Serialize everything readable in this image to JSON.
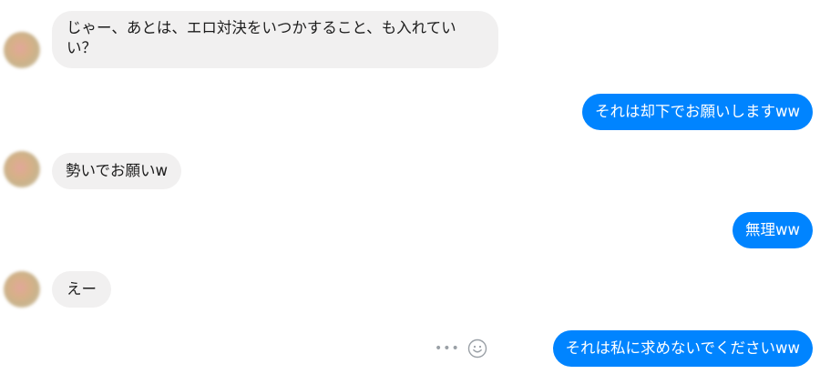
{
  "conversation": {
    "messages": [
      {
        "side": "incoming",
        "text": "じゃー、あとは、エロ対決をいつかすること、も入れていい？"
      },
      {
        "side": "outgoing",
        "text": "それは却下でお願いしますww"
      },
      {
        "side": "incoming",
        "text": "勢いでお願いw"
      },
      {
        "side": "outgoing",
        "text": "無理ww"
      },
      {
        "side": "incoming",
        "text": "えー"
      },
      {
        "side": "outgoing",
        "text": "それは私に求めないでくださいww"
      }
    ]
  },
  "icons": {
    "more": "more-options-icon",
    "react": "smiley-react-icon",
    "avatar": "contact-avatar"
  },
  "colors": {
    "outgoing_bubble": "#0084ff",
    "incoming_bubble": "#f1f0f0",
    "outgoing_text": "#ffffff",
    "incoming_text": "#1c1c1c"
  }
}
